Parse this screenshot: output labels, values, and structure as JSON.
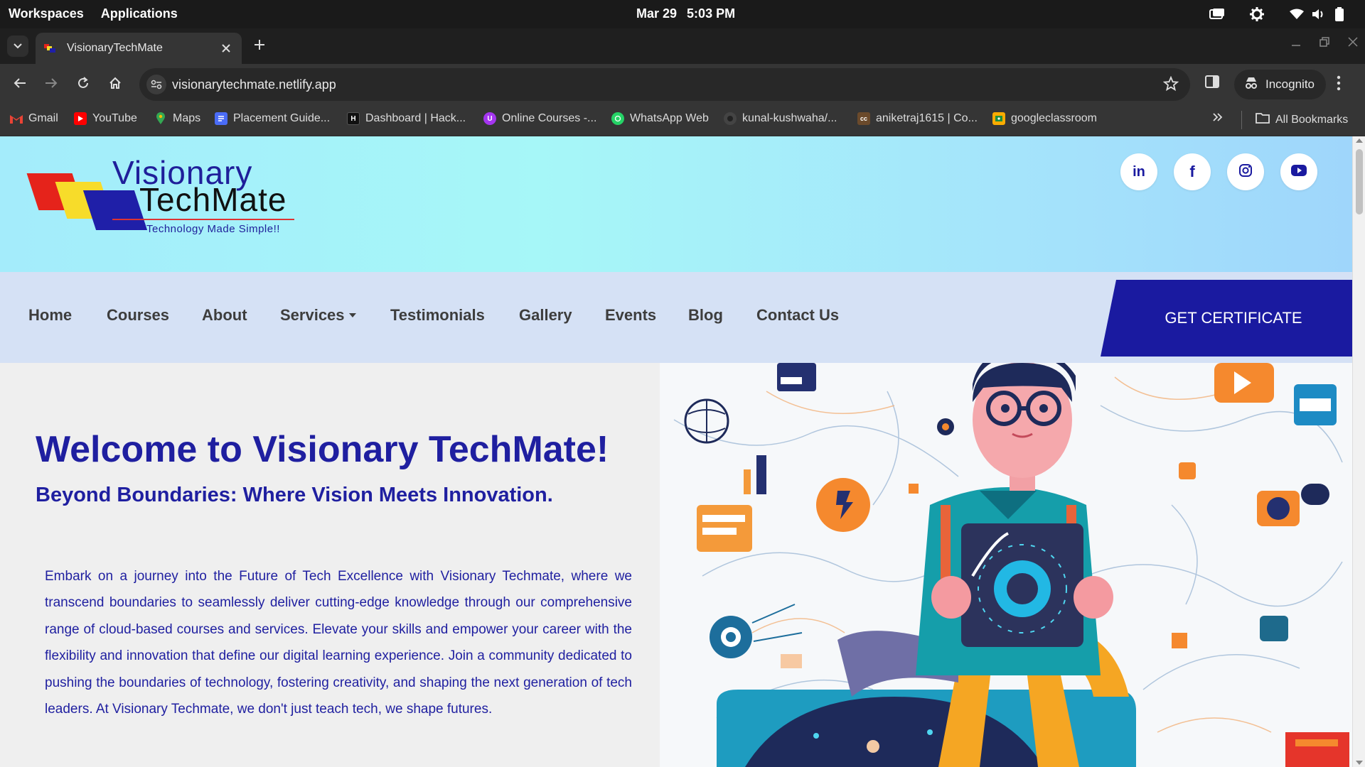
{
  "os": {
    "workspaces": "Workspaces",
    "applications": "Applications",
    "date": "Mar 29",
    "time": "5:03 PM"
  },
  "browser": {
    "tab_title": "VisionaryTechMate",
    "url": "visionarytechmate.netlify.app",
    "incognito_label": "Incognito",
    "bookmarks": [
      {
        "label": "Gmail",
        "icon": "gmail-icon",
        "color": "#ea4335"
      },
      {
        "label": "YouTube",
        "icon": "youtube-icon",
        "color": "#ff0000"
      },
      {
        "label": "Maps",
        "icon": "maps-icon",
        "color": "#34a853"
      },
      {
        "label": "Placement Guide...",
        "icon": "docs-icon",
        "color": "#4a6cf7"
      },
      {
        "label": "Dashboard | Hack...",
        "icon": "hackerrank-icon",
        "color": "#111111"
      },
      {
        "label": "Online Courses -...",
        "icon": "courses-icon",
        "color": "#a435f0"
      },
      {
        "label": "WhatsApp Web",
        "icon": "whatsapp-icon",
        "color": "#25d366"
      },
      {
        "label": "kunal-kushwaha/...",
        "icon": "github-icon",
        "color": "#444444"
      },
      {
        "label": "aniketraj1615 | Co...",
        "icon": "codechef-icon",
        "color": "#6b4a2b"
      },
      {
        "label": "googleclassroom",
        "icon": "classroom-icon",
        "color": "#f9ab00"
      }
    ],
    "all_bookmarks": "All Bookmarks"
  },
  "site": {
    "logo": {
      "line1": "Visionary",
      "line2": "TechMate",
      "tagline": "Technology Made Simple!!"
    },
    "social": [
      {
        "name": "linkedin-icon",
        "glyph": "in"
      },
      {
        "name": "facebook-icon",
        "glyph": "f"
      },
      {
        "name": "instagram-icon",
        "glyph": ""
      },
      {
        "name": "youtube-icon",
        "glyph": ""
      }
    ],
    "nav": {
      "home": "Home",
      "courses": "Courses",
      "about": "About",
      "services": "Services",
      "testimonials": "Testimonials",
      "gallery": "Gallery",
      "events": "Events",
      "blog": "Blog",
      "contact": "Contact Us",
      "cta": "GET CERTIFICATE"
    },
    "hero": {
      "title": "Welcome to Visionary TechMate!",
      "subtitle": "Beyond Boundaries: Where Vision Meets Innovation.",
      "body": "Embark on a journey into the Future of Tech Excellence with Visionary Techmate, where we transcend boundaries to seamlessly deliver cutting-edge knowledge through our comprehensive range of cloud-based courses and services. Elevate your skills and empower your career with the flexibility and innovation that define our digital learning experience. Join a community dedicated to pushing the boundaries of technology, fostering creativity, and shaping the next generation of tech leaders. At Visionary Techmate, we don't just teach tech, we shape futures."
    },
    "colors": {
      "brand_blue": "#1f1fa0",
      "cta_blue": "#1a1aa0",
      "nav_bg": "#d5e1f5",
      "header_bg": "#a6f0fa"
    }
  }
}
